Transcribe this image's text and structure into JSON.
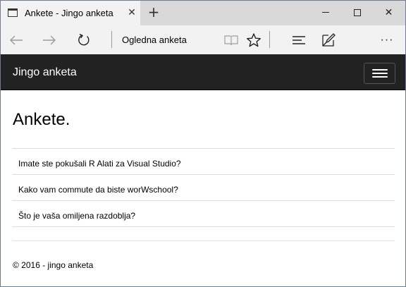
{
  "browser": {
    "tab": {
      "title": "Ankete - Jingo anketa",
      "close_glyph": "✕"
    },
    "new_tab_glyph": "+",
    "window_controls": {
      "close_glyph": "✕"
    },
    "address": {
      "text": "Ogledna anketa"
    },
    "more_glyph": "···"
  },
  "site": {
    "brand": "Jingo anketa",
    "page_title": "Ankete.",
    "polls": [
      {
        "label": "Imate ste pokušali R Alati za Visual Studio?"
      },
      {
        "label": "Kako vam commute da biste worWschool?"
      },
      {
        "label": "Što je vaša omiljena razdoblja?"
      }
    ],
    "footer": "© 2016 - jingo anketa"
  },
  "colors": {
    "navbar_bg": "#222222",
    "chrome_bg": "#f2f2f2",
    "tabstrip_bg": "#d9d9d9",
    "rule": "#dddddd"
  },
  "icons": {
    "back": "back-arrow-icon",
    "forward": "forward-arrow-icon",
    "refresh": "refresh-icon",
    "reading_view": "reading-view-icon",
    "favorite": "star-icon",
    "hub": "hub-icon",
    "web_note": "web-note-icon",
    "menu": "hamburger-icon"
  }
}
